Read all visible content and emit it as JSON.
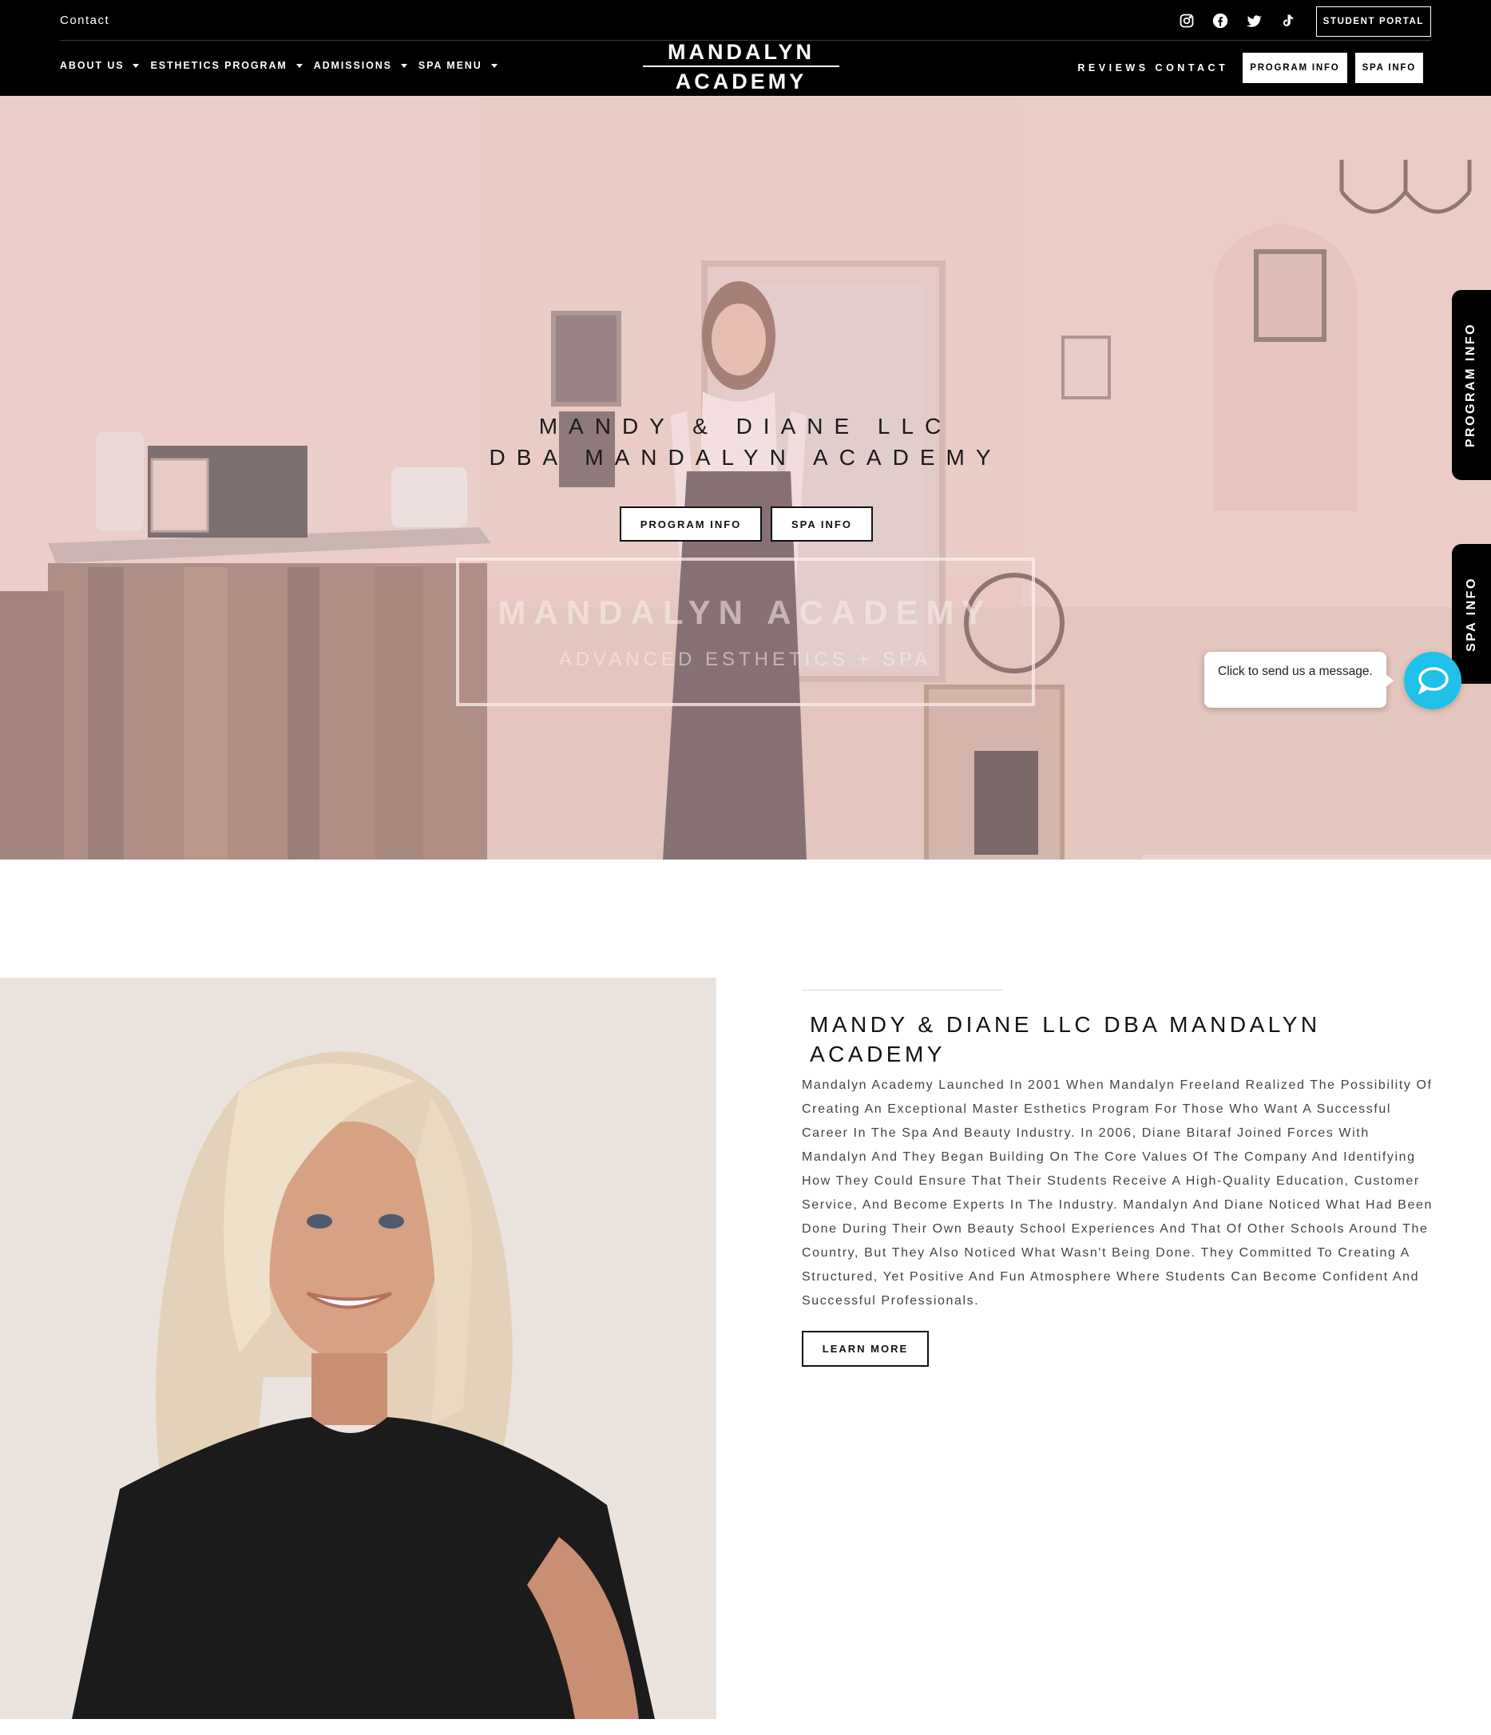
{
  "header": {
    "top_contact": "Contact",
    "student_portal": "STUDENT PORTAL",
    "socials": [
      {
        "name": "instagram-icon"
      },
      {
        "name": "facebook-icon"
      },
      {
        "name": "twitter-icon"
      },
      {
        "name": "tiktok-icon"
      }
    ],
    "nav": [
      {
        "label": "ABOUT US"
      },
      {
        "label": "ESTHETICS PROGRAM"
      },
      {
        "label": "ADMISSIONS"
      },
      {
        "label": "SPA MENU"
      }
    ],
    "logo": {
      "line1": "MANDALYN",
      "line2": "ACADEMY"
    },
    "right_nav": {
      "reviews": "REVIEWS",
      "contact": "CONTACT",
      "program_info": "PROGRAM INFO",
      "spa_info": "SPA INFO"
    }
  },
  "hero": {
    "title_line1": "MANDY & DIANE LLC",
    "title_line2": "DBA MANDALYN ACADEMY",
    "btn_program": "PROGRAM INFO",
    "btn_spa": "SPA INFO",
    "sign_line1": "MANDALYN ACADEMY",
    "sign_line2": "ADVANCED ESTHETICS + SPA"
  },
  "side_tabs": {
    "program": "PROGRAM INFO",
    "spa": "SPA INFO"
  },
  "chat": {
    "bubble_text": "Click to send us a message."
  },
  "about": {
    "title": "MANDY & DIANE LLC DBA MANDALYN ACADEMY",
    "body": "Mandalyn Academy Launched In 2001 When Mandalyn Freeland Realized The Possibility Of Creating An Exceptional Master Esthetics Program For Those Who Want A Successful Career In The Spa And Beauty Industry. In 2006, Diane Bitaraf Joined Forces With Mandalyn And They Began Building On The Core Values Of The Company And Identifying How They Could Ensure That Their Students Receive A High-Quality Education, Customer Service, And Become Experts In The Industry. Mandalyn And Diane Noticed What Had Been Done During Their Own Beauty School Experiences And That Of Other Schools Around The Country, But They Also Noticed What Wasn't Being Done. They Committed To Creating A Structured, Yet Positive And Fun Atmosphere Where Students Can Become Confident And Successful Professionals.",
    "learn_more": "LEARN MORE"
  },
  "colors": {
    "header_bg": "#000000",
    "chat_accent": "#1fc0ea",
    "hero_tint": "#dfc1b9"
  }
}
